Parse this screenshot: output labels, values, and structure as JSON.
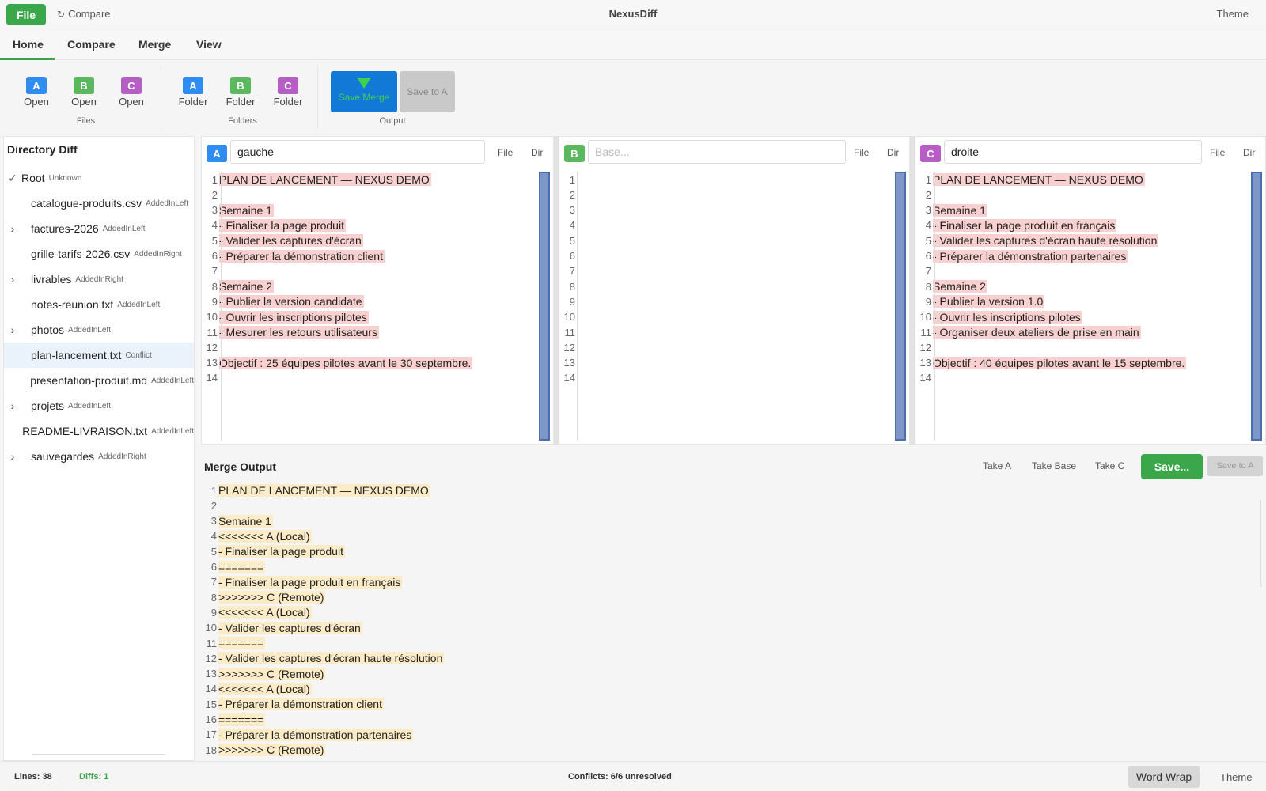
{
  "app": {
    "title": "NexusDiff",
    "file_label": "File",
    "compare_label": "Compare",
    "theme_label": "Theme"
  },
  "menu": {
    "tabs": [
      "Home",
      "Compare",
      "Merge",
      "View"
    ]
  },
  "ribbon": {
    "files_group": {
      "label": "Files",
      "buttons": [
        {
          "badge": "A",
          "label": "Open"
        },
        {
          "badge": "B",
          "label": "Open"
        },
        {
          "badge": "C",
          "label": "Open"
        }
      ]
    },
    "folders_group": {
      "label": "Folders",
      "buttons": [
        {
          "badge": "A",
          "label": "Folder"
        },
        {
          "badge": "B",
          "label": "Folder"
        },
        {
          "badge": "C",
          "label": "Folder"
        }
      ]
    },
    "output_group": {
      "label": "Output",
      "save_merge": "Save Merge",
      "save_to_a": "Save to A"
    }
  },
  "sidebar": {
    "title": "Directory Diff",
    "items": [
      {
        "chevron": "✓",
        "name": "Root",
        "status": "Unknown"
      },
      {
        "chevron": "",
        "name": "catalogue-produits.csv",
        "status": "AddedInLeft"
      },
      {
        "chevron": "›",
        "name": "factures-2026",
        "status": "AddedInLeft"
      },
      {
        "chevron": "",
        "name": "grille-tarifs-2026.csv",
        "status": "AddedInRight"
      },
      {
        "chevron": "›",
        "name": "livrables",
        "status": "AddedInRight"
      },
      {
        "chevron": "",
        "name": "notes-reunion.txt",
        "status": "AddedInLeft"
      },
      {
        "chevron": "›",
        "name": "photos",
        "status": "AddedInLeft"
      },
      {
        "chevron": "",
        "name": "plan-lancement.txt",
        "status": "Conflict",
        "selected": true
      },
      {
        "chevron": "",
        "name": "presentation-produit.md",
        "status": "AddedInLeft"
      },
      {
        "chevron": "›",
        "name": "projets",
        "status": "AddedInLeft"
      },
      {
        "chevron": "",
        "name": "README-LIVRAISON.txt",
        "status": "AddedInLeft"
      },
      {
        "chevron": "›",
        "name": "sauvegardes",
        "status": "AddedInRight"
      }
    ]
  },
  "panes": {
    "a": {
      "badge": "A",
      "value": "gauche",
      "placeholder": "",
      "file_label": "File",
      "dir_label": "Dir",
      "lines": [
        {
          "n": "1",
          "t": "PLAN DE LANCEMENT — NEXUS DEMO",
          "hl": true
        },
        {
          "n": "2",
          "t": "",
          "hl": false
        },
        {
          "n": "3",
          "t": "Semaine 1",
          "hl": true
        },
        {
          "n": "4",
          "t": "- Finaliser la page produit",
          "hl": true
        },
        {
          "n": "5",
          "t": "- Valider les captures d'écran",
          "hl": true
        },
        {
          "n": "6",
          "t": "- Préparer la démonstration client",
          "hl": true
        },
        {
          "n": "7",
          "t": "",
          "hl": false
        },
        {
          "n": "8",
          "t": "Semaine 2",
          "hl": true
        },
        {
          "n": "9",
          "t": "- Publier la version candidate",
          "hl": true
        },
        {
          "n": "10",
          "t": "- Ouvrir les inscriptions pilotes",
          "hl": true
        },
        {
          "n": "11",
          "t": "- Mesurer les retours utilisateurs",
          "hl": true
        },
        {
          "n": "12",
          "t": "",
          "hl": false
        },
        {
          "n": "13",
          "t": "Objectif : 25 équipes pilotes avant le 30 septembre.",
          "hl": true
        },
        {
          "n": "14",
          "t": "",
          "hl": false
        }
      ]
    },
    "b": {
      "badge": "B",
      "value": "",
      "placeholder": "Base...",
      "file_label": "File",
      "dir_label": "Dir",
      "lines": [
        {
          "n": "1",
          "t": "",
          "hl": false
        },
        {
          "n": "2",
          "t": "",
          "hl": false
        },
        {
          "n": "3",
          "t": "",
          "hl": false
        },
        {
          "n": "4",
          "t": "",
          "hl": false
        },
        {
          "n": "5",
          "t": "",
          "hl": false
        },
        {
          "n": "6",
          "t": "",
          "hl": false
        },
        {
          "n": "7",
          "t": "",
          "hl": false
        },
        {
          "n": "8",
          "t": "",
          "hl": false
        },
        {
          "n": "9",
          "t": "",
          "hl": false
        },
        {
          "n": "10",
          "t": "",
          "hl": false
        },
        {
          "n": "11",
          "t": "",
          "hl": false
        },
        {
          "n": "12",
          "t": "",
          "hl": false
        },
        {
          "n": "13",
          "t": "",
          "hl": false
        },
        {
          "n": "14",
          "t": "",
          "hl": false
        }
      ]
    },
    "c": {
      "badge": "C",
      "value": "droite",
      "placeholder": "",
      "file_label": "File",
      "dir_label": "Dir",
      "lines": [
        {
          "n": "1",
          "t": "PLAN DE LANCEMENT — NEXUS DEMO",
          "hl": true
        },
        {
          "n": "2",
          "t": "",
          "hl": false
        },
        {
          "n": "3",
          "t": "Semaine 1",
          "hl": true
        },
        {
          "n": "4",
          "t": "- Finaliser la page produit en français",
          "hl": true
        },
        {
          "n": "5",
          "t": "- Valider les captures d'écran haute résolution",
          "hl": true
        },
        {
          "n": "6",
          "t": "- Préparer la démonstration partenaires",
          "hl": true
        },
        {
          "n": "7",
          "t": "",
          "hl": false
        },
        {
          "n": "8",
          "t": "Semaine 2",
          "hl": true
        },
        {
          "n": "9",
          "t": "- Publier la version 1.0",
          "hl": true
        },
        {
          "n": "10",
          "t": "- Ouvrir les inscriptions pilotes",
          "hl": true
        },
        {
          "n": "11",
          "t": "- Organiser deux ateliers de prise en main",
          "hl": true
        },
        {
          "n": "12",
          "t": "",
          "hl": false
        },
        {
          "n": "13",
          "t": "Objectif : 40 équipes pilotes avant le 15 septembre.",
          "hl": true
        },
        {
          "n": "14",
          "t": "",
          "hl": false
        }
      ]
    }
  },
  "merge": {
    "title": "Merge Output",
    "take_a": "Take A",
    "take_base": "Take Base",
    "take_c": "Take C",
    "save": "Save...",
    "save_to_a": "Save to A",
    "lines": [
      {
        "n": "1",
        "t": "PLAN DE LANCEMENT — NEXUS DEMO",
        "hl": true
      },
      {
        "n": "2",
        "t": "",
        "hl": false
      },
      {
        "n": "3",
        "t": "Semaine 1",
        "hl": true
      },
      {
        "n": "4",
        "t": "<<<<<<< A (Local)",
        "hl": true
      },
      {
        "n": "5",
        "t": "- Finaliser la page produit",
        "hl": true
      },
      {
        "n": "6",
        "t": "=======",
        "hl": true
      },
      {
        "n": "7",
        "t": "- Finaliser la page produit en français",
        "hl": true
      },
      {
        "n": "8",
        "t": ">>>>>>> C (Remote)",
        "hl": true
      },
      {
        "n": "9",
        "t": "<<<<<<< A (Local)",
        "hl": true
      },
      {
        "n": "10",
        "t": "- Valider les captures d'écran",
        "hl": true
      },
      {
        "n": "11",
        "t": "=======",
        "hl": true
      },
      {
        "n": "12",
        "t": "- Valider les captures d'écran haute résolution",
        "hl": true
      },
      {
        "n": "13",
        "t": ">>>>>>> C (Remote)",
        "hl": true
      },
      {
        "n": "14",
        "t": "<<<<<<< A (Local)",
        "hl": true
      },
      {
        "n": "15",
        "t": "- Préparer la démonstration client",
        "hl": true
      },
      {
        "n": "16",
        "t": "=======",
        "hl": true
      },
      {
        "n": "17",
        "t": "- Préparer la démonstration partenaires",
        "hl": true
      },
      {
        "n": "18",
        "t": ">>>>>>> C (Remote)",
        "hl": true
      }
    ]
  },
  "status": {
    "lines": "Lines: 38",
    "diffs": "Diffs: 1",
    "conflicts": "Conflicts: 6/6 unresolved",
    "word_wrap": "Word Wrap",
    "theme": "Theme"
  },
  "colors": {
    "accent_green": "#3aa84a",
    "badge_a": "#2f8cf0",
    "badge_b": "#5cb85c",
    "badge_c": "#b75ec6",
    "diff_highlight": "#f7d0cf",
    "merge_highlight": "#fbecc7",
    "save_merge_blue": "#1279d6"
  },
  "icons": {
    "compare": "refresh-icon",
    "save_merge": "down-arrow-icon",
    "tree_expand": "chevron-right-icon",
    "tree_expanded": "check-icon"
  }
}
